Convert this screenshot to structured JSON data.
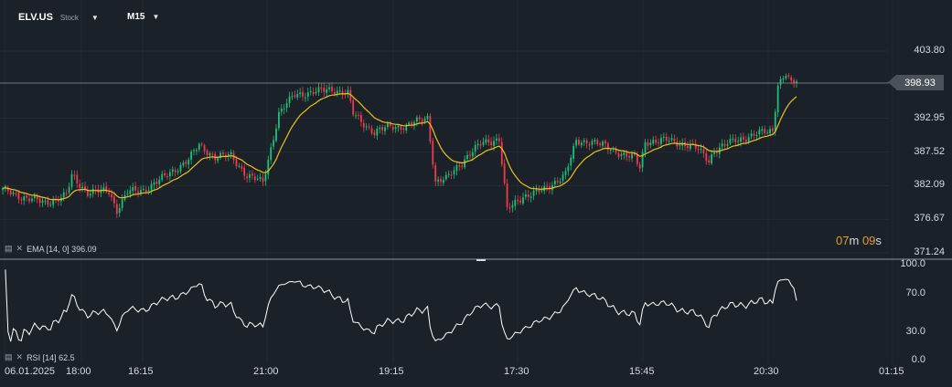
{
  "header": {
    "ticker": "ELV.US",
    "ticker_type": "Stock",
    "timeframe": "M15"
  },
  "indicators": {
    "ema_label": "EMA [14, 0] 396.09",
    "rsi_label": "RSI [14] 62.5"
  },
  "timer": {
    "minutes": "07",
    "m_unit": "m",
    "seconds": "09",
    "s_unit": "s"
  },
  "current_price": "398.93",
  "colors": {
    "background": "#1a2128",
    "up_candle": "#1fc07a",
    "down_candle": "#ef3b4f",
    "ema_line": "#e9c21c",
    "rsi_line": "#ffffff",
    "grid": "#2a323a",
    "divider": "#8a939b"
  },
  "chart_data": [
    {
      "type": "candlestick",
      "title": "ELV.US",
      "ylim": [
        371.24,
        406.5
      ],
      "y_ticks": [
        "403.80",
        "398.93",
        "392.95",
        "387.52",
        "382.09",
        "376.67",
        "371.24"
      ],
      "x_ticks": [
        "06.01.2025",
        "18:00",
        "16:15",
        "21:00",
        "19:15",
        "17:30",
        "15:45",
        "20:30",
        "01:15"
      ],
      "close_path": [
        [
          0,
          381.4
        ],
        [
          8,
          380.2
        ],
        [
          16,
          379.3
        ],
        [
          24,
          380.5
        ],
        [
          26,
          383.6
        ],
        [
          32,
          381.0
        ],
        [
          40,
          381.2
        ],
        [
          43,
          378.2
        ],
        [
          47,
          381.0
        ],
        [
          53,
          381.4
        ],
        [
          60,
          383.2
        ],
        [
          70,
          386.3
        ],
        [
          74,
          388.6
        ],
        [
          80,
          386.7
        ],
        [
          86,
          386.9
        ],
        [
          92,
          383.7
        ],
        [
          98,
          382.6
        ],
        [
          104,
          393.7
        ],
        [
          110,
          396.8
        ],
        [
          118,
          397.2
        ],
        [
          124,
          397.7
        ],
        [
          130,
          396.9
        ],
        [
          132,
          393.7
        ],
        [
          140,
          390.6
        ],
        [
          146,
          391.7
        ],
        [
          152,
          391.6
        ],
        [
          160,
          393.2
        ],
        [
          163,
          382.6
        ],
        [
          167,
          383.1
        ],
        [
          171,
          385.1
        ],
        [
          177,
          387.6
        ],
        [
          181,
          389.1
        ],
        [
          187,
          389.6
        ],
        [
          190,
          378.1
        ],
        [
          196,
          380.4
        ],
        [
          204,
          381.4
        ],
        [
          212,
          384.0
        ],
        [
          216,
          389.1
        ],
        [
          222,
          389.3
        ],
        [
          230,
          387.8
        ],
        [
          238,
          386.5
        ],
        [
          240,
          384.9
        ],
        [
          242,
          389.2
        ],
        [
          250,
          389.4
        ],
        [
          258,
          388.7
        ],
        [
          262,
          387.9
        ],
        [
          266,
          386.1
        ],
        [
          268,
          387.8
        ],
        [
          276,
          389.4
        ],
        [
          284,
          390.4
        ],
        [
          290,
          391.0
        ],
        [
          292,
          398.5
        ],
        [
          295,
          400.1
        ],
        [
          297,
          398.4
        ],
        [
          299,
          398.9
        ]
      ],
      "ema_label": "EMA [14, 0] 396.09",
      "last_price": 398.93,
      "countdown": "07m 09s"
    },
    {
      "type": "line",
      "title": "RSI [14] 62.5",
      "ylim": [
        0,
        100
      ],
      "y_ticks": [
        "100.0",
        "70.0",
        "30.0",
        "0.0"
      ],
      "last_value": 62.5
    }
  ]
}
